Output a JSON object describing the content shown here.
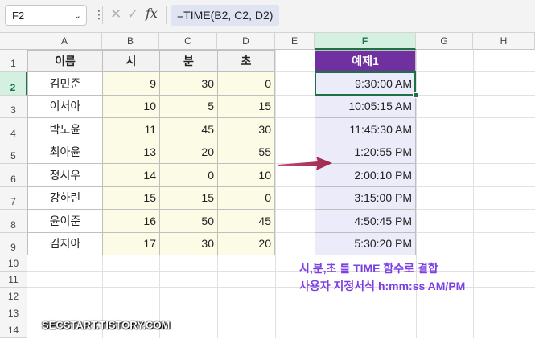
{
  "formula_bar": {
    "name_box": "F2",
    "dropdown_icon": "chevron-down-icon",
    "more_icon": "vertical-dots-icon",
    "cancel_icon": "cross-icon",
    "enter_icon": "check-icon",
    "function_icon": "fx",
    "formula": "=TIME(B2, C2, D2)"
  },
  "columns": [
    "A",
    "B",
    "C",
    "D",
    "E",
    "F",
    "G",
    "H"
  ],
  "rows": [
    "1",
    "2",
    "3",
    "4",
    "5",
    "6",
    "7",
    "8",
    "9",
    "10",
    "11",
    "12",
    "13",
    "14"
  ],
  "selected_cell": "F2",
  "table": {
    "headers": [
      "이름",
      "시",
      "분",
      "초"
    ],
    "rows": [
      {
        "name": "김민준",
        "h": "9",
        "m": "30",
        "s": "0"
      },
      {
        "name": "이서아",
        "h": "10",
        "m": "5",
        "s": "15"
      },
      {
        "name": "박도윤",
        "h": "11",
        "m": "45",
        "s": "30"
      },
      {
        "name": "최아윤",
        "h": "13",
        "m": "20",
        "s": "55"
      },
      {
        "name": "정시우",
        "h": "14",
        "m": "0",
        "s": "10"
      },
      {
        "name": "강하린",
        "h": "15",
        "m": "15",
        "s": "0"
      },
      {
        "name": "윤이준",
        "h": "16",
        "m": "50",
        "s": "45"
      },
      {
        "name": "김지아",
        "h": "17",
        "m": "30",
        "s": "20"
      }
    ]
  },
  "example": {
    "header": "예제1",
    "values": [
      "9:30:00 AM",
      "10:05:15 AM",
      "11:45:30 AM",
      "1:20:55 PM",
      "2:00:10 PM",
      "3:15:00 PM",
      "4:50:45 PM",
      "5:30:20 PM"
    ]
  },
  "annotation": {
    "line1": "시,분,초 를 TIME 함수로 결합",
    "line2": "사용자 지정서식 h:mm:ss AM/PM",
    "arrow_icon": "arrow-right-icon"
  },
  "watermark": "SECSTART.TISTORY.COM",
  "colors": {
    "accent_green": "#1e7145",
    "header_purple": "#7030a0",
    "arrow": "#b3365c",
    "note_text": "#7b3fe4"
  }
}
